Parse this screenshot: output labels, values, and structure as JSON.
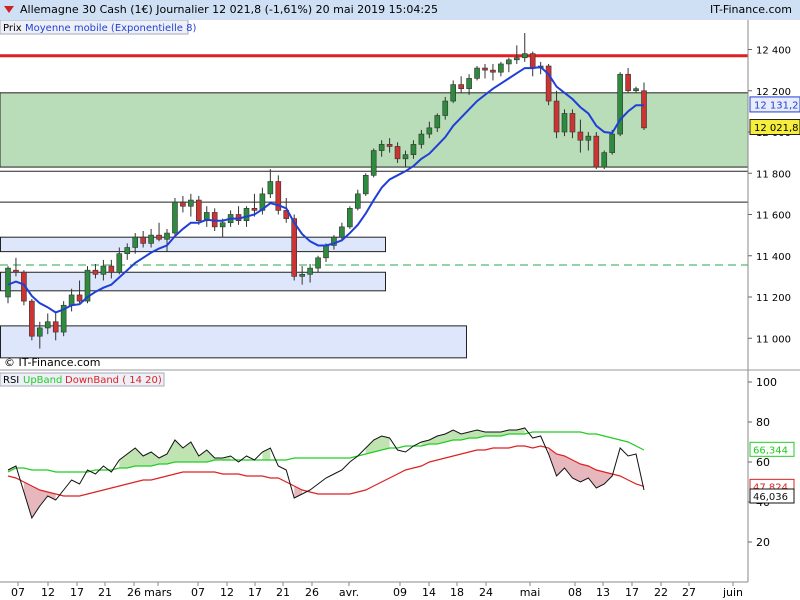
{
  "header": {
    "title": "Allemagne 30 Cash (1€)   Journalier   12 021,8 (-1,61%)   20 mai 2019 15:04:25",
    "site": "IT-Finance.com"
  },
  "price_panel": {
    "label_prix": "Prix",
    "label_ma": "Moyenne mobile (Exponentielle 8)",
    "watermark": "© IT-Finance.com",
    "last_ma_label": "12 131,2",
    "last_price_label": "12 021,8",
    "yticks": [
      "12 400",
      "12 200",
      "12 000",
      "11 800",
      "11 600",
      "11 400",
      "11 200",
      "11 000"
    ]
  },
  "rsi_panel": {
    "label_rsi": "RSI",
    "label_up": "UpBand",
    "label_down": "DownBand ( 14 20)",
    "yticks": [
      "100",
      "80",
      "60",
      "40",
      "20"
    ],
    "up_label": "66,344",
    "down_label": "47,824",
    "rsi_label": "46,036"
  },
  "xaxis": {
    "ticks": [
      "07",
      "12",
      "17",
      "21",
      "26",
      "mars",
      "07",
      "12",
      "17",
      "21",
      "26",
      "avr.",
      "09",
      "14",
      "18",
      "24",
      "mai",
      "08",
      "13",
      "17",
      "22",
      "27",
      "juin"
    ]
  },
  "colors": {
    "up": "#2e8b3e",
    "down": "#cc3333",
    "ma": "#1f3fd6",
    "resistance": "#e02020",
    "zone_green": "#b9dcb9",
    "zone_blue": "#dde6fb",
    "rsi_up": "#22cc22",
    "rsi_down": "#dd2222"
  },
  "chart_data": {
    "type": "candlestick",
    "title": "Allemagne 30 Cash (1€) Journalier",
    "ylim": [
      10880,
      12480
    ],
    "resistance": 12370,
    "support_dashed": 11355,
    "zones": [
      {
        "kind": "green",
        "from": 11830,
        "to": 12190
      },
      {
        "kind": "line",
        "value": 11810
      },
      {
        "kind": "line",
        "value": 11660
      },
      {
        "kind": "blue",
        "from": 11420,
        "to": 11490
      },
      {
        "kind": "blue",
        "from": 11230,
        "to": 11320
      },
      {
        "kind": "blue",
        "from": 10905,
        "to": 11060
      }
    ],
    "candles": [
      [
        11200,
        11350,
        11170,
        11340
      ],
      [
        11330,
        11390,
        11300,
        11320
      ],
      [
        11320,
        11330,
        11160,
        11180
      ],
      [
        11180,
        11190,
        10990,
        11010
      ],
      [
        11010,
        11080,
        10950,
        11050
      ],
      [
        11050,
        11120,
        11020,
        11080
      ],
      [
        11080,
        11120,
        10990,
        11030
      ],
      [
        11030,
        11180,
        11010,
        11160
      ],
      [
        11160,
        11240,
        11130,
        11210
      ],
      [
        11210,
        11280,
        11170,
        11180
      ],
      [
        11180,
        11350,
        11170,
        11330
      ],
      [
        11330,
        11360,
        11290,
        11310
      ],
      [
        11310,
        11380,
        11280,
        11350
      ],
      [
        11350,
        11380,
        11290,
        11320
      ],
      [
        11320,
        11440,
        11310,
        11410
      ],
      [
        11410,
        11460,
        11380,
        11440
      ],
      [
        11440,
        11510,
        11410,
        11490
      ],
      [
        11490,
        11520,
        11440,
        11460
      ],
      [
        11460,
        11530,
        11440,
        11500
      ],
      [
        11500,
        11560,
        11470,
        11480
      ],
      [
        11480,
        11530,
        11420,
        11510
      ],
      [
        11510,
        11680,
        11500,
        11660
      ],
      [
        11660,
        11690,
        11610,
        11640
      ],
      [
        11640,
        11700,
        11590,
        11670
      ],
      [
        11670,
        11690,
        11550,
        11570
      ],
      [
        11570,
        11640,
        11540,
        11610
      ],
      [
        11610,
        11630,
        11520,
        11540
      ],
      [
        11540,
        11580,
        11490,
        11560
      ],
      [
        11560,
        11620,
        11540,
        11600
      ],
      [
        11600,
        11640,
        11550,
        11570
      ],
      [
        11570,
        11640,
        11540,
        11630
      ],
      [
        11630,
        11700,
        11590,
        11620
      ],
      [
        11620,
        11730,
        11600,
        11700
      ],
      [
        11700,
        11820,
        11680,
        11760
      ],
      [
        11760,
        11790,
        11600,
        11620
      ],
      [
        11620,
        11680,
        11560,
        11580
      ],
      [
        11580,
        11600,
        11280,
        11300
      ],
      [
        11300,
        11350,
        11260,
        11310
      ],
      [
        11310,
        11360,
        11270,
        11340
      ],
      [
        11340,
        11400,
        11320,
        11390
      ],
      [
        11390,
        11460,
        11370,
        11450
      ],
      [
        11450,
        11500,
        11430,
        11490
      ],
      [
        11490,
        11560,
        11470,
        11540
      ],
      [
        11540,
        11640,
        11530,
        11630
      ],
      [
        11630,
        11720,
        11620,
        11700
      ],
      [
        11700,
        11800,
        11690,
        11790
      ],
      [
        11790,
        11920,
        11780,
        11910
      ],
      [
        11910,
        11960,
        11880,
        11940
      ],
      [
        11940,
        11970,
        11900,
        11930
      ],
      [
        11930,
        11950,
        11850,
        11870
      ],
      [
        11870,
        11910,
        11830,
        11890
      ],
      [
        11890,
        11960,
        11870,
        11940
      ],
      [
        11940,
        12010,
        11920,
        11990
      ],
      [
        11990,
        12050,
        11970,
        12020
      ],
      [
        12020,
        12090,
        12000,
        12080
      ],
      [
        12080,
        12170,
        12060,
        12150
      ],
      [
        12150,
        12250,
        12140,
        12230
      ],
      [
        12230,
        12270,
        12190,
        12210
      ],
      [
        12210,
        12280,
        12180,
        12260
      ],
      [
        12260,
        12320,
        12250,
        12310
      ],
      [
        12310,
        12330,
        12260,
        12300
      ],
      [
        12300,
        12330,
        12250,
        12290
      ],
      [
        12290,
        12340,
        12270,
        12330
      ],
      [
        12330,
        12360,
        12290,
        12350
      ],
      [
        12350,
        12420,
        12330,
        12360
      ],
      [
        12360,
        12480,
        12340,
        12380
      ],
      [
        12380,
        12390,
        12270,
        12310
      ],
      [
        12310,
        12340,
        12280,
        12320
      ],
      [
        12320,
        12330,
        12130,
        12150
      ],
      [
        12150,
        12200,
        11970,
        12000
      ],
      [
        12000,
        12110,
        11980,
        12090
      ],
      [
        12090,
        12110,
        11970,
        12000
      ],
      [
        12000,
        12060,
        11900,
        11960
      ],
      [
        11960,
        12000,
        11910,
        11980
      ],
      [
        11980,
        12000,
        11820,
        11830
      ],
      [
        11830,
        11910,
        11820,
        11900
      ],
      [
        11900,
        12010,
        11890,
        11990
      ],
      [
        11990,
        12290,
        11980,
        12280
      ],
      [
        12280,
        12310,
        12190,
        12200
      ],
      [
        12200,
        12220,
        12190,
        12210
      ],
      [
        12200,
        12240,
        12010,
        12020
      ]
    ],
    "ma": [
      11260,
      11275,
      11260,
      11205,
      11170,
      11150,
      11125,
      11140,
      11160,
      11165,
      11200,
      11225,
      11245,
      11260,
      11295,
      11330,
      11365,
      11390,
      11415,
      11435,
      11450,
      11495,
      11530,
      11560,
      11560,
      11575,
      11570,
      11570,
      11580,
      11580,
      11590,
      11600,
      11625,
      11655,
      11645,
      11630,
      11560,
      11505,
      11470,
      11450,
      11450,
      11460,
      11475,
      11510,
      11550,
      11605,
      11670,
      11730,
      11770,
      11790,
      11810,
      11835,
      11870,
      11895,
      11935,
      11975,
      12030,
      12070,
      12110,
      12150,
      12180,
      12210,
      12235,
      12260,
      12285,
      12310,
      12310,
      12315,
      12280,
      12220,
      12190,
      12160,
      12120,
      12090,
      12030,
      12000,
      11995,
      12060,
      12100,
      12130,
      12130
    ],
    "rsi": [
      56,
      58,
      45,
      32,
      38,
      43,
      41,
      46,
      51,
      49,
      56,
      54,
      58,
      55,
      61,
      64,
      67,
      63,
      65,
      62,
      64,
      71,
      67,
      70,
      63,
      66,
      62,
      62,
      63,
      60,
      63,
      61,
      65,
      67,
      58,
      56,
      42,
      44,
      46,
      49,
      52,
      54,
      56,
      60,
      63,
      67,
      71,
      73,
      72,
      66,
      65,
      68,
      70,
      71,
      73,
      74,
      76,
      74,
      75,
      76,
      75,
      75,
      75,
      76,
      76,
      77,
      72,
      73,
      64,
      53,
      57,
      52,
      50,
      52,
      47,
      49,
      53,
      67,
      63,
      64,
      46
    ],
    "upband": [
      55,
      57,
      57,
      56,
      56,
      56,
      55,
      55,
      55,
      55,
      55,
      56,
      56,
      56,
      57,
      57,
      58,
      58,
      58,
      59,
      59,
      60,
      60,
      60,
      60,
      60,
      61,
      61,
      61,
      61,
      61,
      61,
      61,
      61,
      61,
      61,
      62,
      62,
      62,
      62,
      62,
      62,
      62,
      62,
      63,
      64,
      65,
      66,
      67,
      67,
      68,
      68,
      68,
      69,
      69,
      70,
      71,
      71,
      72,
      72,
      73,
      73,
      73,
      74,
      74,
      74,
      75,
      75,
      75,
      75,
      75,
      75,
      75,
      74,
      74,
      73,
      72,
      71,
      70,
      68,
      66
    ],
    "downband": [
      53,
      52,
      50,
      48,
      46,
      45,
      44,
      43,
      43,
      43,
      44,
      45,
      46,
      47,
      48,
      49,
      50,
      51,
      51,
      52,
      53,
      54,
      55,
      55,
      55,
      55,
      55,
      54,
      54,
      54,
      53,
      53,
      53,
      52,
      52,
      50,
      48,
      46,
      45,
      44,
      44,
      44,
      44,
      44,
      45,
      46,
      48,
      50,
      52,
      54,
      56,
      57,
      58,
      60,
      61,
      62,
      63,
      64,
      65,
      66,
      66,
      67,
      67,
      67,
      68,
      68,
      67,
      68,
      67,
      64,
      63,
      61,
      59,
      58,
      56,
      55,
      54,
      53,
      51,
      49,
      47.8
    ],
    "rsi_ylim": [
      0,
      100
    ]
  }
}
